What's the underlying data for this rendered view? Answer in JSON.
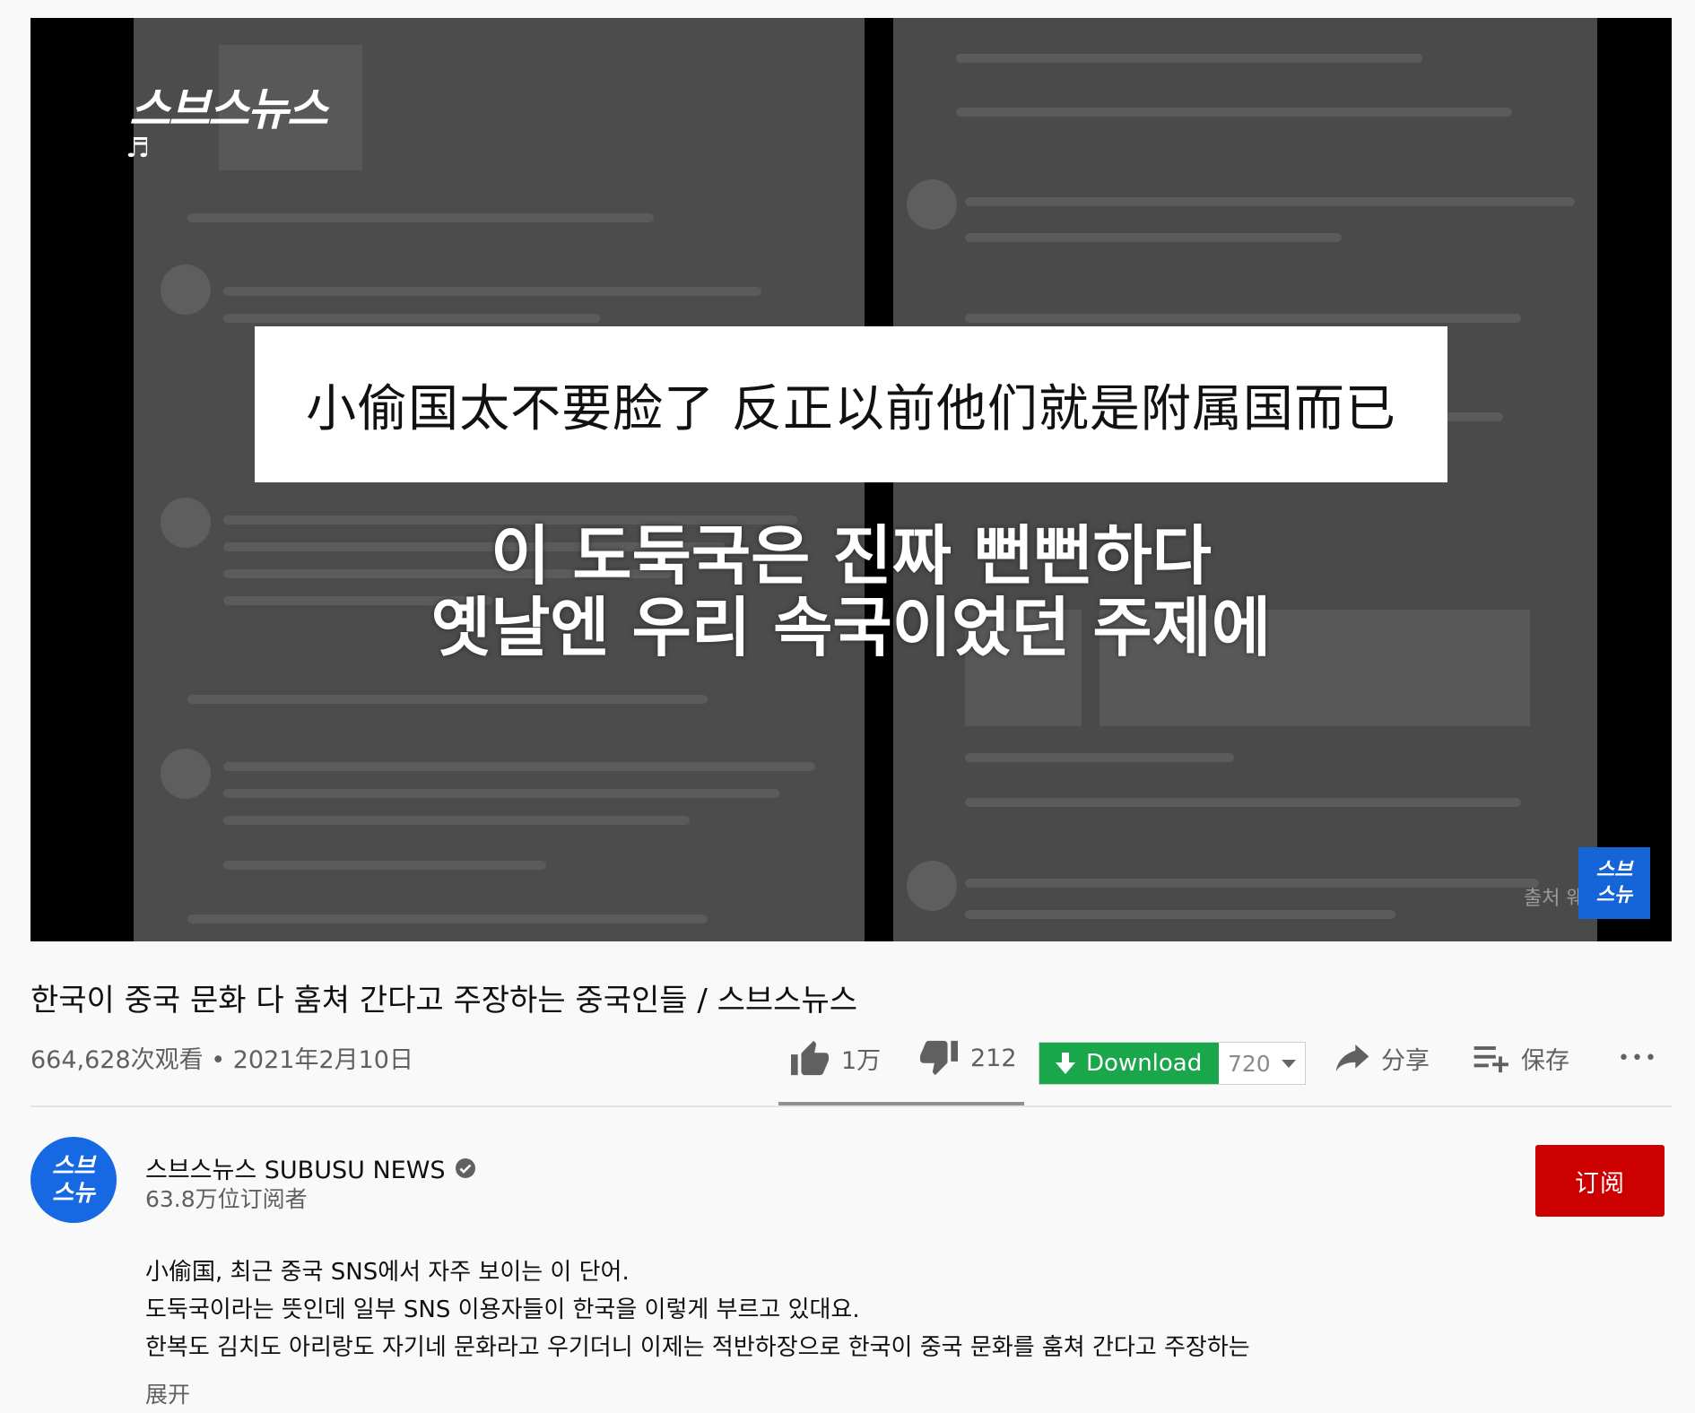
{
  "player": {
    "logo_text": "스브스뉴스",
    "music_glyph": "♬",
    "caption_chinese": "小偷国太不要脸了 反正以前他们就是附属国而已",
    "subtitle_line1": "이 도둑국은 진짜 뻔뻔하다",
    "subtitle_line2": "옛날엔 우리 속국이었던 주제에",
    "source_text": "출처 웨",
    "badge_text": "스브\n스뉴"
  },
  "video": {
    "title": "한국이 중국 문화 다 훔쳐 간다고 주장하는 중국인들 / 스브스뉴스",
    "views_date": "664,628次观看 • 2021年2月10日"
  },
  "actions": {
    "like_count": "1万",
    "dislike_count": "212",
    "download_label": "Download",
    "download_quality": "720",
    "share_label": "分享",
    "save_label": "保存",
    "more_glyph": "•••"
  },
  "channel": {
    "avatar_text": "스브\n스뉴",
    "name": "스브스뉴스 SUBUSU NEWS",
    "subscribers": "63.8万位订阅者",
    "subscribe_label": "订阅"
  },
  "description": {
    "line1": "小偷国, 최근 중국 SNS에서 자주 보이는 이 단어.",
    "line2": "도둑국이라는 뜻인데 일부 SNS 이용자들이 한국을 이렇게 부르고 있대요.",
    "line3": "한복도 김치도 아리랑도 자기네 문화라고 우기더니 이제는 적반하장으로 한국이 중국 문화를 훔쳐 간다고 주장하는",
    "show_more": "展开"
  },
  "colors": {
    "subscribe_red": "#cc0000",
    "download_green": "#1aa64a",
    "brand_blue": "#1668e3"
  }
}
